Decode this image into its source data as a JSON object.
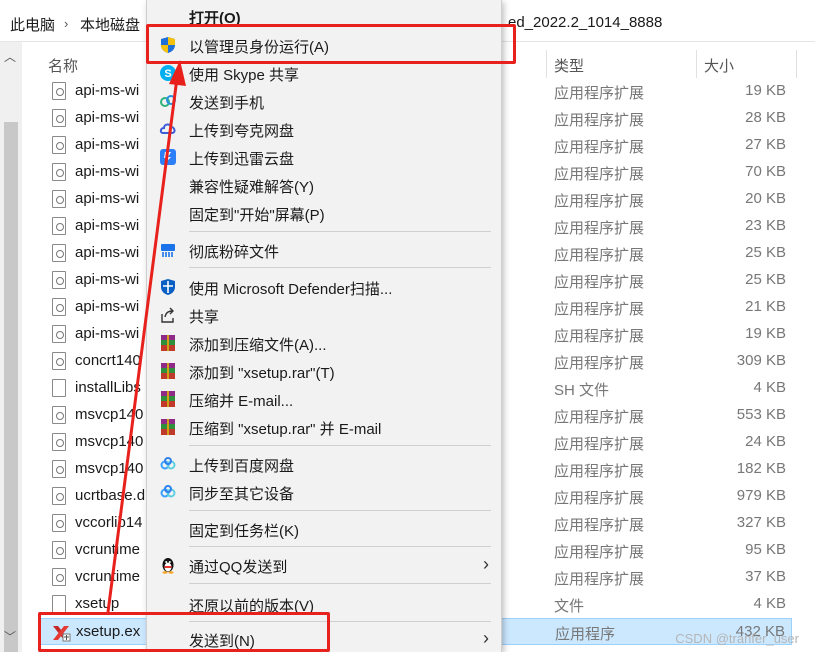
{
  "breadcrumb": {
    "this_pc": "此电脑",
    "local_disk": "本地磁盘",
    "folder_tail": "ed_2022.2_1014_8888"
  },
  "columns": {
    "name": "名称",
    "type": "类型",
    "size": "大小"
  },
  "files": [
    {
      "name": "api-ms-wi",
      "type": "应用程序扩展",
      "size": "19 KB",
      "icon": "dll-icon"
    },
    {
      "name": "api-ms-wi",
      "type": "应用程序扩展",
      "size": "28 KB",
      "icon": "dll-icon"
    },
    {
      "name": "api-ms-wi",
      "type": "应用程序扩展",
      "size": "27 KB",
      "icon": "dll-icon"
    },
    {
      "name": "api-ms-wi",
      "type": "应用程序扩展",
      "size": "70 KB",
      "icon": "dll-icon"
    },
    {
      "name": "api-ms-wi",
      "type": "应用程序扩展",
      "size": "20 KB",
      "icon": "dll-icon"
    },
    {
      "name": "api-ms-wi",
      "type": "应用程序扩展",
      "size": "23 KB",
      "icon": "dll-icon"
    },
    {
      "name": "api-ms-wi",
      "type": "应用程序扩展",
      "size": "25 KB",
      "icon": "dll-icon"
    },
    {
      "name": "api-ms-wi",
      "type": "应用程序扩展",
      "size": "25 KB",
      "icon": "dll-icon"
    },
    {
      "name": "api-ms-wi",
      "type": "应用程序扩展",
      "size": "21 KB",
      "icon": "dll-icon"
    },
    {
      "name": "api-ms-wi",
      "type": "应用程序扩展",
      "size": "19 KB",
      "icon": "dll-icon"
    },
    {
      "name": "concrt140",
      "type": "应用程序扩展",
      "size": "309 KB",
      "icon": "dll-icon"
    },
    {
      "name": "installLibs",
      "type": "SH 文件",
      "size": "4 KB",
      "icon": "file-icon"
    },
    {
      "name": "msvcp140",
      "type": "应用程序扩展",
      "size": "553 KB",
      "icon": "dll-icon"
    },
    {
      "name": "msvcp140",
      "type": "应用程序扩展",
      "size": "24 KB",
      "icon": "dll-icon"
    },
    {
      "name": "msvcp140",
      "type": "应用程序扩展",
      "size": "182 KB",
      "icon": "dll-icon"
    },
    {
      "name": "ucrtbase.d",
      "type": "应用程序扩展",
      "size": "979 KB",
      "icon": "dll-icon"
    },
    {
      "name": "vccorlib14",
      "type": "应用程序扩展",
      "size": "327 KB",
      "icon": "dll-icon"
    },
    {
      "name": "vcruntime",
      "type": "应用程序扩展",
      "size": "95 KB",
      "icon": "dll-icon"
    },
    {
      "name": "vcruntime",
      "type": "应用程序扩展",
      "size": "37 KB",
      "icon": "dll-icon"
    },
    {
      "name": "xsetup",
      "type": "文件",
      "size": "4 KB",
      "icon": "file-icon"
    },
    {
      "name": "xsetup.ex",
      "type": "应用程序",
      "size": "432 KB",
      "icon": "xilinx-icon",
      "selected": true
    }
  ],
  "menu": {
    "open": "打开(O)",
    "run_as_admin": "以管理员身份运行(A)",
    "skype_share": "使用 Skype 共享",
    "send_to_phone": "发送到手机",
    "upload_quark": "上传到夸克网盘",
    "upload_xunlei": "上传到迅雷云盘",
    "compat_troubleshoot": "兼容性疑难解答(Y)",
    "pin_start": "固定到\"开始\"屏幕(P)",
    "shred": "彻底粉碎文件",
    "defender_scan": "使用 Microsoft Defender扫描...",
    "share": "共享",
    "add_to_archive": "添加到压缩文件(A)...",
    "add_to_rar": "添加到 \"xsetup.rar\"(T)",
    "compress_email": "压缩并 E-mail...",
    "compress_rar_email": "压缩到 \"xsetup.rar\" 并 E-mail",
    "upload_baidu": "上传到百度网盘",
    "sync_devices": "同步至其它设备",
    "pin_taskbar": "固定到任务栏(K)",
    "send_qq": "通过QQ发送到",
    "restore_prev": "还原以前的版本(V)",
    "send_to": "发送到(N)"
  },
  "colors": {
    "annotation_red": "#e8211d",
    "selection": "#cce8ff"
  },
  "watermark": "CSDN @tranfer_user"
}
